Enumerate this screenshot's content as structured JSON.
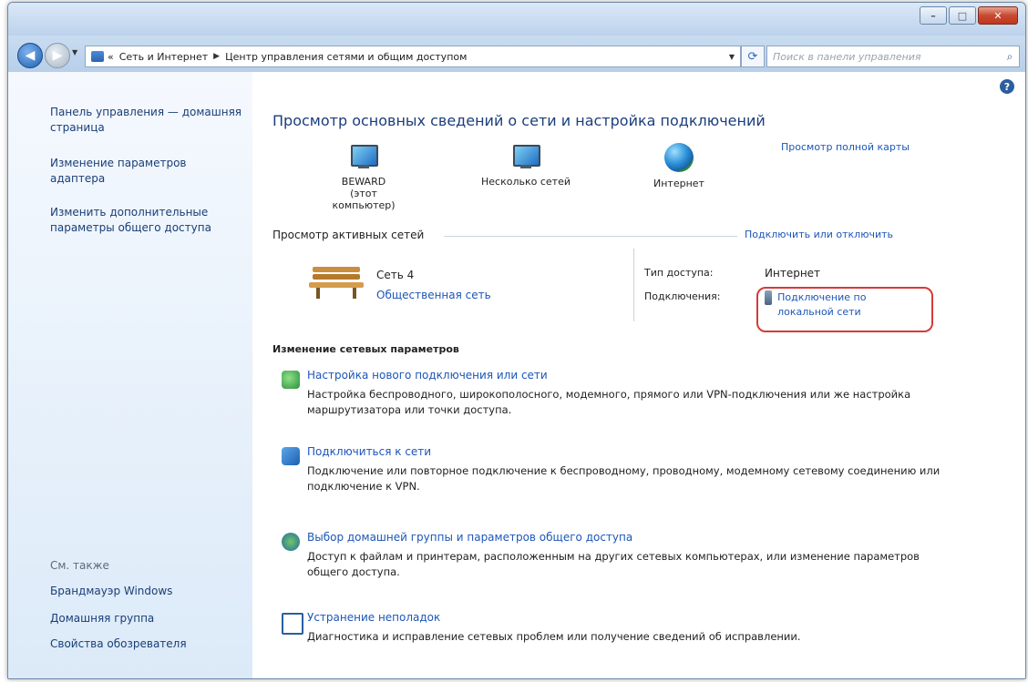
{
  "window": {
    "caption_buttons": [
      "–",
      "□",
      "✕"
    ]
  },
  "navbar": {
    "address_prefix": "«",
    "breadcrumb_1": "Сеть и Интернет",
    "breadcrumb_2": "Центр управления сетями и общим доступом",
    "search_placeholder": "Поиск в панели управления"
  },
  "sidebar": {
    "links": [
      "Панель управления — домашняя страница",
      "Изменение параметров адаптера",
      "Изменить дополнительные параметры общего доступа"
    ],
    "see_also_label": "См. также",
    "see_also_links": [
      "Брандмауэр Windows",
      "Домашняя группа",
      "Свойства обозревателя"
    ]
  },
  "main": {
    "title": "Просмотр основных сведений о сети и настройка подключений",
    "full_map_link": "Просмотр полной карты",
    "nodes": [
      {
        "name": "BEWARD",
        "sub": "(этот компьютер)"
      },
      {
        "name": "Несколько сетей",
        "sub": ""
      },
      {
        "name": "Интернет",
        "sub": ""
      }
    ],
    "active_networks_label": "Просмотр активных сетей",
    "connect_disconnect_link": "Подключить или отключить",
    "network": {
      "name": "Сеть 4",
      "type_link": "Общественная сеть",
      "access_type_label": "Тип доступа:",
      "access_type_value": "Интернет",
      "connections_label": "Подключения:",
      "connection_link": "Подключение по локальной сети"
    },
    "change_settings_label": "Изменение сетевых параметров",
    "tasks": [
      {
        "icon": "new-connection-icon",
        "title": "Настройка нового подключения или сети",
        "desc": "Настройка беспроводного, широкополосного, модемного, прямого или VPN-подключения или же настройка маршрутизатора или точки доступа."
      },
      {
        "icon": "connect-network-icon",
        "title": "Подключиться к сети",
        "desc": "Подключение или повторное подключение к беспроводному, проводному, модемному сетевому соединению или подключение к VPN."
      },
      {
        "icon": "homegroup-icon",
        "title": "Выбор домашней группы и параметров общего доступа",
        "desc": "Доступ к файлам и принтерам, расположенным на других сетевых компьютерах, или изменение параметров общего доступа."
      },
      {
        "icon": "troubleshoot-icon",
        "title": "Устранение неполадок",
        "desc": "Диагностика и исправление сетевых проблем или получение сведений об исправлении."
      }
    ]
  }
}
